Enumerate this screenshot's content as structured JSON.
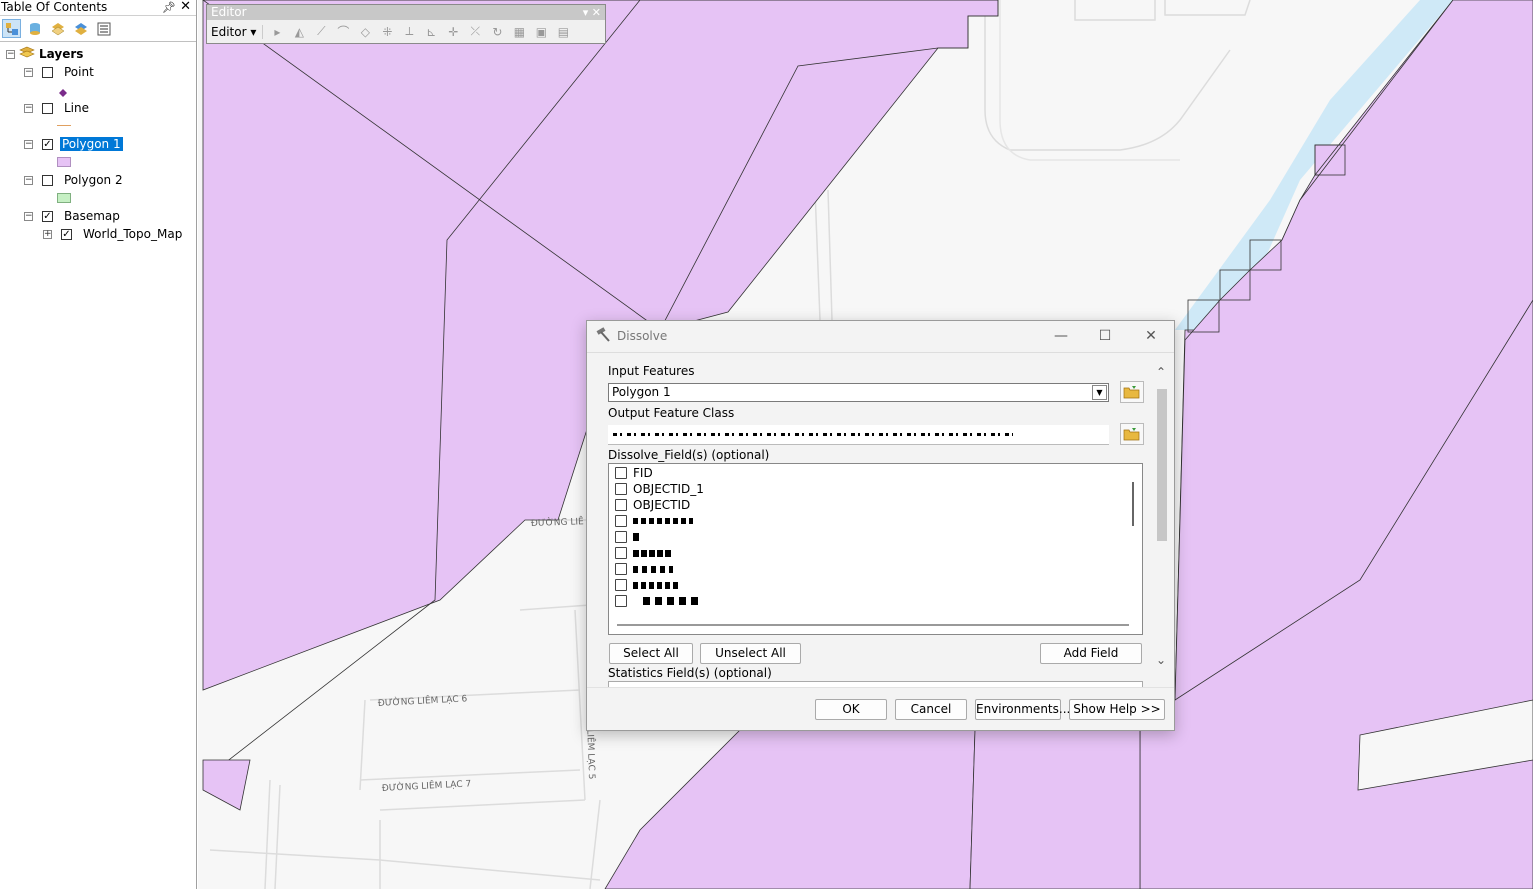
{
  "toc": {
    "title": "Table Of Contents",
    "pin": "ᵖ",
    "close": "✕",
    "root_label": "Layers",
    "layers": [
      {
        "label": "Point",
        "checked": false,
        "expanded": true
      },
      {
        "label": "Line",
        "checked": false,
        "expanded": true
      },
      {
        "label": "Polygon 1",
        "checked": true,
        "expanded": true,
        "selected": true
      },
      {
        "label": "Polygon 2",
        "checked": false,
        "expanded": true
      },
      {
        "label": "Basemap",
        "checked": true,
        "expanded": true
      },
      {
        "label": "World_Topo_Map",
        "checked": true,
        "expanded": false
      }
    ],
    "colors": {
      "polygon1": "#e6c3f5",
      "polygon2": "#c6f0c4",
      "point": "#7a2b8a",
      "line": "#e0a060",
      "selection": "#0078d7"
    }
  },
  "editor": {
    "title": "Editor",
    "menu_label": "Editor ▾"
  },
  "map": {
    "labels": {
      "street1": "ĐƯỜNG LIÊM LẠC 6",
      "street2": "ĐƯỜNG LIÊM LẠC 7",
      "street3": "ĐƯỜNG LIÊM LẠC 5",
      "street4": "ĐƯỜNG LIÊ"
    },
    "colors": {
      "polygon": "#e6c3f5",
      "water": "#cfe9f7",
      "background": "#f7f7f7",
      "road": "#ffffff"
    }
  },
  "dialog": {
    "title": "Dissolve",
    "input_features_label": "Input Features",
    "input_features_value": "Polygon 1",
    "output_class_label": "Output Feature Class",
    "dissolve_fields_label": "Dissolve_Field(s) (optional)",
    "fields": [
      "FID",
      "OBJECTID_1",
      "OBJECTID"
    ],
    "select_all": "Select All",
    "unselect_all": "Unselect All",
    "add_field": "Add Field",
    "statistics_label": "Statistics Field(s) (optional)",
    "ok": "OK",
    "cancel": "Cancel",
    "environments": "Environments...",
    "show_help": "Show Help >>"
  }
}
